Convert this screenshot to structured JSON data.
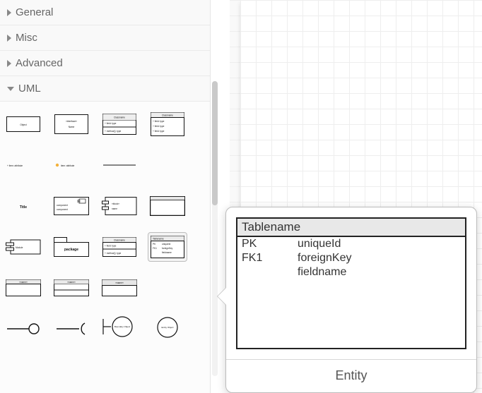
{
  "sidebar": {
    "categories": [
      {
        "label": "General",
        "open": false
      },
      {
        "label": "Misc",
        "open": false
      },
      {
        "label": "Advanced",
        "open": false
      },
      {
        "label": "UML",
        "open": true
      }
    ],
    "shapes": {
      "object_label": "Object",
      "interface_top": "«interface»",
      "interface_name": "Name",
      "class3_title": "Classname",
      "class3_row1": "+ field: type",
      "class3_row2": "+ method(): type",
      "class4_title": "Classname",
      "class4_row1": "+ field: type",
      "class4_row2": "+ field: type",
      "class4_row3": "+ field: type",
      "item_attr1": "+ item: attribute",
      "item_attr2": "item: attribute",
      "title_label": "Title",
      "component_a": "component",
      "component_b": "component",
      "block_a": "«block»",
      "block_b": "name",
      "module_label": "Module",
      "package_label": "package",
      "small_class_title": "Classname",
      "small_class_r1": "+ field: type",
      "small_class_r2": "+ method(): type",
      "entity_mini_title": "Tablename",
      "entity_mini_r1a": "PK",
      "entity_mini_r1b": "uniqueId",
      "entity_mini_r2a": "FK1",
      "entity_mini_r2b": "foreignKey",
      "entity_mini_r3b": "fieldname",
      "tab_simple_title": "«name»",
      "tab_two_title": "«name»",
      "tab_header_title": "«name»",
      "boundary_label": "Boundary Object",
      "entityobj_label": "Entity Object"
    }
  },
  "tooltip": {
    "table_name": "Tablename",
    "rows": [
      {
        "key": "PK",
        "field": "uniqueId"
      },
      {
        "key": "FK1",
        "field": "foreignKey"
      },
      {
        "key": "",
        "field": "fieldname"
      }
    ],
    "caption": "Entity"
  }
}
